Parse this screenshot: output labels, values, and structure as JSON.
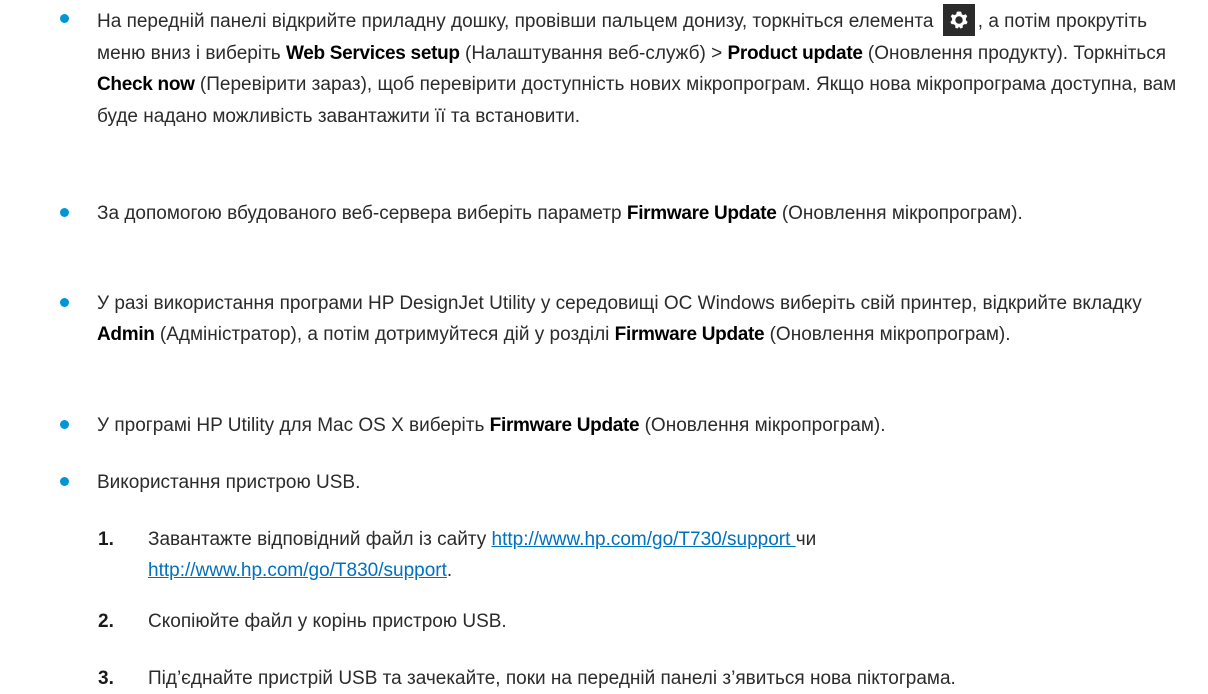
{
  "bullets": [
    {
      "t1": "На передній панелі відкрийте приладну дошку, провівши пальцем донизу, торкніться елемента ",
      "icon": "gear-icon",
      "t2": ", а потім прокрутіть меню вниз і виберіть ",
      "b1": "Web Services setup",
      "t3": " (Налаштування веб-служб) > ",
      "b2": "Product update",
      "t4": " (Оновлення продукту). Торкніться ",
      "b3": "Check now",
      "t5": " (Перевірити зараз), щоб перевірити доступність нових мікропрограм. Якщо нова мікропрограма доступна, вам буде надано можливість завантажити її та встановити."
    },
    {
      "t1": "За допомогою вбудованого веб-сервера виберіть параметр ",
      "b1": "Firmware Update",
      "t2": " (Оновлення мікропрограм)."
    },
    {
      "t1": "У разі використання програми HP DesignJet Utility у середовищі ОС Windows виберіть свій принтер, відкрийте вкладку ",
      "b1": "Admin",
      "t2": " (Адміністратор), а потім дотримуйтеся дій у розділі ",
      "b2": "Firmware Update",
      "t3": " (Оновлення мікропрограм)."
    },
    {
      "t1": "У програмі HP Utility для Mac OS X виберіть ",
      "b1": "Firmware Update",
      "t2": " (Оновлення мікропрограм)."
    },
    {
      "t1": "Використання пристрою USB."
    }
  ],
  "steps": [
    {
      "num": "1.",
      "t1": "Завантажте відповідний файл із сайту ",
      "link1": "http://www.hp.com/go/T730/support ",
      "t2": "чи",
      "link2": "http://www.hp.com/go/T830/support",
      "t3": "."
    },
    {
      "num": "2.",
      "t1": "Скопіюйте файл у корінь пристрою USB."
    },
    {
      "num": "3.",
      "t1": "Під’єднайте пристрій USB та зачекайте, поки на передній панелі з’явиться нова піктограма."
    }
  ],
  "colors": {
    "bullet": "#0096d6",
    "link": "#0070c0",
    "text": "#2b2b2b"
  }
}
